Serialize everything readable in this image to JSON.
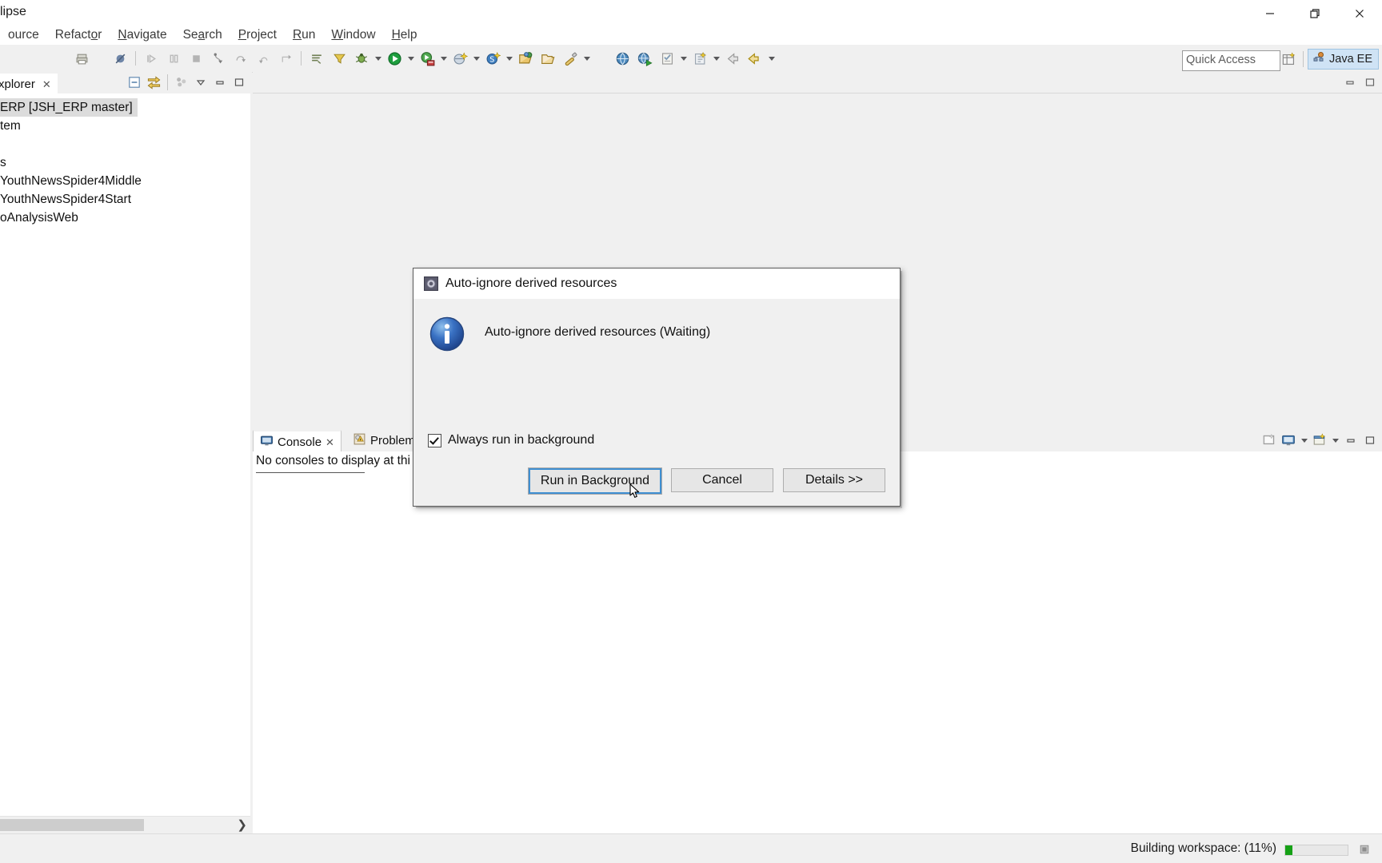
{
  "window": {
    "title": "clipse",
    "controls": [
      {
        "name": "minimize",
        "glyph": "minimize-icon"
      },
      {
        "name": "maximize",
        "glyph": "maximize-icon"
      },
      {
        "name": "close",
        "glyph": "close-icon"
      }
    ]
  },
  "menubar": {
    "items": [
      {
        "label": "ource",
        "mnemonic": ""
      },
      {
        "label": "Refactor",
        "mnemonic": "o"
      },
      {
        "label": "Navigate",
        "mnemonic": "N"
      },
      {
        "label": "Search",
        "mnemonic": "a"
      },
      {
        "label": "Project",
        "mnemonic": "P"
      },
      {
        "label": "Run",
        "mnemonic": "R"
      },
      {
        "label": "Window",
        "mnemonic": "W"
      },
      {
        "label": "Help",
        "mnemonic": "H"
      }
    ]
  },
  "toolbar": {
    "icons": [
      "print-icon",
      "skip-breakpoints-icon",
      "resume-icon",
      "suspend-icon",
      "terminate-icon",
      "step-into-icon",
      "step-over-icon",
      "step-return-icon",
      "drop-to-frame-icon",
      "next-annotation-icon",
      "previous-annotation-icon",
      "debug-icon",
      "run-icon",
      "run-as-server-icon",
      "new-wizard-icon",
      "new-dynamic-web-project-icon",
      "open-type-icon",
      "open-task-icon",
      "search-icon",
      "external-tools-icon",
      "new-class-icon",
      "new-java-project-icon",
      "back-icon",
      "forward-icon"
    ],
    "quick_access": {
      "placeholder": "Quick Access",
      "value": "Quick Access"
    },
    "perspective": {
      "open_perspective_icon": "open-perspective-icon",
      "active_label": "Java EE",
      "active_icon": "java-ee-perspective-icon"
    }
  },
  "explorer": {
    "tab_label": "xplorer",
    "tab_close": "✕",
    "tools": [
      "collapse-all-icon",
      "link-with-editor-icon",
      "view-menu-icon",
      "minimize-icon",
      "maximize-icon"
    ],
    "tree": [
      {
        "label": "ERP  [JSH_ERP master]",
        "selected": true
      },
      {
        "label": "tem",
        "selected": false
      },
      {
        "label": "",
        "selected": false
      },
      {
        "label": "s",
        "selected": false
      },
      {
        "label": "YouthNewsSpider4Middle",
        "selected": false
      },
      {
        "label": "YouthNewsSpider4Start",
        "selected": false
      },
      {
        "label": "oAnalysisWeb",
        "selected": false
      }
    ],
    "scroll_arrow": "❯"
  },
  "console": {
    "tabs": [
      {
        "label": "Console",
        "icon": "console-icon",
        "active": true,
        "closable": true
      },
      {
        "label": "Problems",
        "icon": "problems-icon",
        "active": false,
        "closable": false
      }
    ],
    "message": "No consoles to display at thi",
    "tools": [
      "open-console-icon",
      "display-selected-console-icon",
      "dropdown-icon",
      "new-console-view-icon",
      "dropdown-icon",
      "minimize-icon",
      "maximize-icon"
    ]
  },
  "statusbar": {
    "message": "Building workspace: (11%)",
    "progress_percent": 11,
    "progress_fill_color": "#16a116",
    "stop_icon": "stop-job-icon"
  },
  "dialog": {
    "title": "Auto-ignore derived resources",
    "title_icon": "progress-gear-icon",
    "info_icon": "info-icon",
    "message": "Auto-ignore derived resources (Waiting)",
    "checkbox": {
      "label": "Always run in background",
      "checked": true
    },
    "buttons": [
      {
        "label": "Run in Background",
        "default": true,
        "name": "run-in-background-button"
      },
      {
        "label": "Cancel",
        "default": false,
        "name": "cancel-button"
      },
      {
        "label": "Details >>",
        "default": false,
        "name": "details-button"
      }
    ]
  },
  "colors": {
    "accent": "#3f8fd2",
    "perspective_bg": "#cfe3f5",
    "progress_green": "#16a116",
    "selection": "#dcdcdc"
  }
}
